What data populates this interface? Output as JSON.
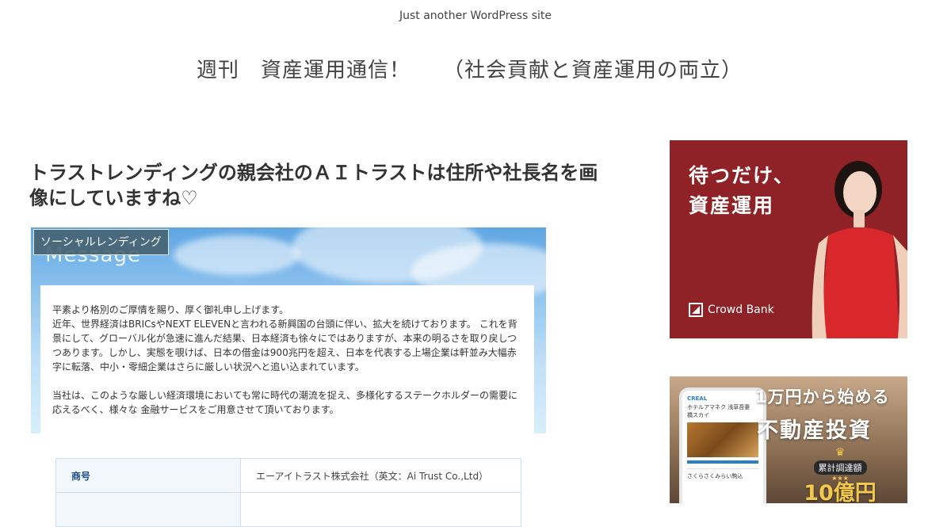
{
  "site": {
    "tagline": "Just another WordPress site",
    "title": "週刊　資産運用通信！　　（社会貢献と資産運用の両立）"
  },
  "post": {
    "title": "トラストレンディングの親会社のＡＩトラストは住所や社長名を画像にしていますね♡",
    "category": "ソーシャルレンディング",
    "image": {
      "heading": "Message",
      "paragraph1": "平素より格別のご厚情を賜り、厚く御礼申し上げます。\n近年、世界経済はBRICsやNEXT ELEVENと言われる新興国の台頭に伴い、拡大を続けております。 これを背景にして、グローバル化が急速に進んだ結果、日本経済も徐々にではありますが、本来の明るさを取り戻しつつあります。しかし、実態を覗けば、日本の借金は900兆円を超え、日本を代表する上場企業は軒並み大幅赤字に転落、中小・零細企業はさらに厳しい状況へと追い込まれています。",
      "paragraph2": "当社は、このような厳しい経済環境においても常に時代の潮流を捉え、多様化するステークホルダーの需要に応えるべく、様々な 金融サービスをご用意させて頂いております。"
    },
    "table": {
      "rows": [
        {
          "label": "商号",
          "value": "エーアイトラスト株式会社（英文：Ai Trust Co.,Ltd）"
        },
        {
          "label": "",
          "value": ""
        }
      ]
    }
  },
  "ads": {
    "crowdbank": {
      "line1": "待つだけ、",
      "line2": "資産運用",
      "brand": "Crowd Bank",
      "accent": "#8e2226"
    },
    "creal": {
      "line1": "1万円から始める",
      "line2": "不動産投資",
      "app_brand": "CREAL",
      "app_line1": "ホテルアマネク 浅草吾妻",
      "app_line2": "橋スカイ",
      "app_place": "さくらさくみらい駒込",
      "medal_label": "累計調達額",
      "medal_value": "10億円",
      "accent": "#f2c94c"
    }
  }
}
